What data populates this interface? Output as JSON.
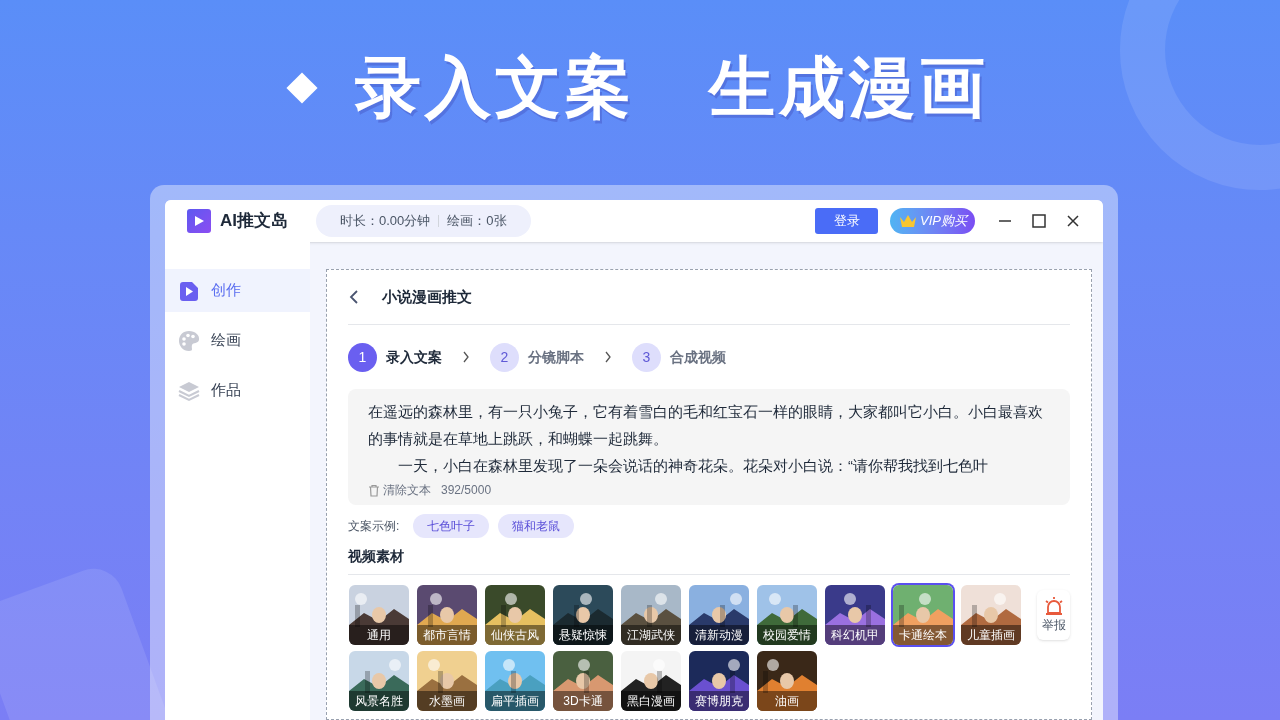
{
  "headline": [
    "录入文案",
    "生成漫画"
  ],
  "app": {
    "name": "AI推文岛",
    "stats": [
      "时长：0.00分钟",
      "绘画：0张"
    ],
    "login": "登录",
    "vip": "VIP购买"
  },
  "sidebar": {
    "items": [
      {
        "label": "创作",
        "selected": true
      },
      {
        "label": "绘画",
        "selected": false
      },
      {
        "label": "作品",
        "selected": false
      }
    ]
  },
  "page": {
    "title": "小说漫画推文",
    "steps": [
      {
        "number": "1",
        "label": "录入文案",
        "selected": true
      },
      {
        "number": "2",
        "label": "分镜脚本",
        "selected": false
      },
      {
        "number": "3",
        "label": "合成视频",
        "selected": false
      }
    ],
    "text": [
      "在遥远的森林里，有一只小兔子，它有着雪白的毛和红宝石一样的眼睛，大家都叫它小白。小白最喜欢的事情就是在草地上跳跃，和蝴蝶一起跳舞。",
      "一天，小白在森林里发现了一朵会说话的神奇花朵。花朵对小白说：“请你帮我找到七色叶"
    ],
    "clear": "清除文本",
    "count": "392/5000",
    "examples_label": "文案示例:",
    "examples": [
      "七色叶子",
      "猫和老鼠"
    ],
    "materials_title": "视频素材",
    "materials": [
      {
        "label": "通用",
        "selected": false
      },
      {
        "label": "都市言情",
        "selected": false
      },
      {
        "label": "仙侠古风",
        "selected": false
      },
      {
        "label": "悬疑惊悚",
        "selected": false
      },
      {
        "label": "江湖武侠",
        "selected": false
      },
      {
        "label": "清新动漫",
        "selected": false
      },
      {
        "label": "校园爱情",
        "selected": false
      },
      {
        "label": "科幻机甲",
        "selected": false
      },
      {
        "label": "卡通绘本",
        "selected": true
      },
      {
        "label": "儿童插画",
        "selected": false
      },
      {
        "label": "风景名胜",
        "selected": false
      },
      {
        "label": "水墨画",
        "selected": false
      },
      {
        "label": "扁平插画",
        "selected": false
      },
      {
        "label": "3D卡通",
        "selected": false
      },
      {
        "label": "黑白漫画",
        "selected": false
      },
      {
        "label": "赛博朋克",
        "selected": false
      },
      {
        "label": "油画",
        "selected": false
      }
    ],
    "report": "举报"
  }
}
